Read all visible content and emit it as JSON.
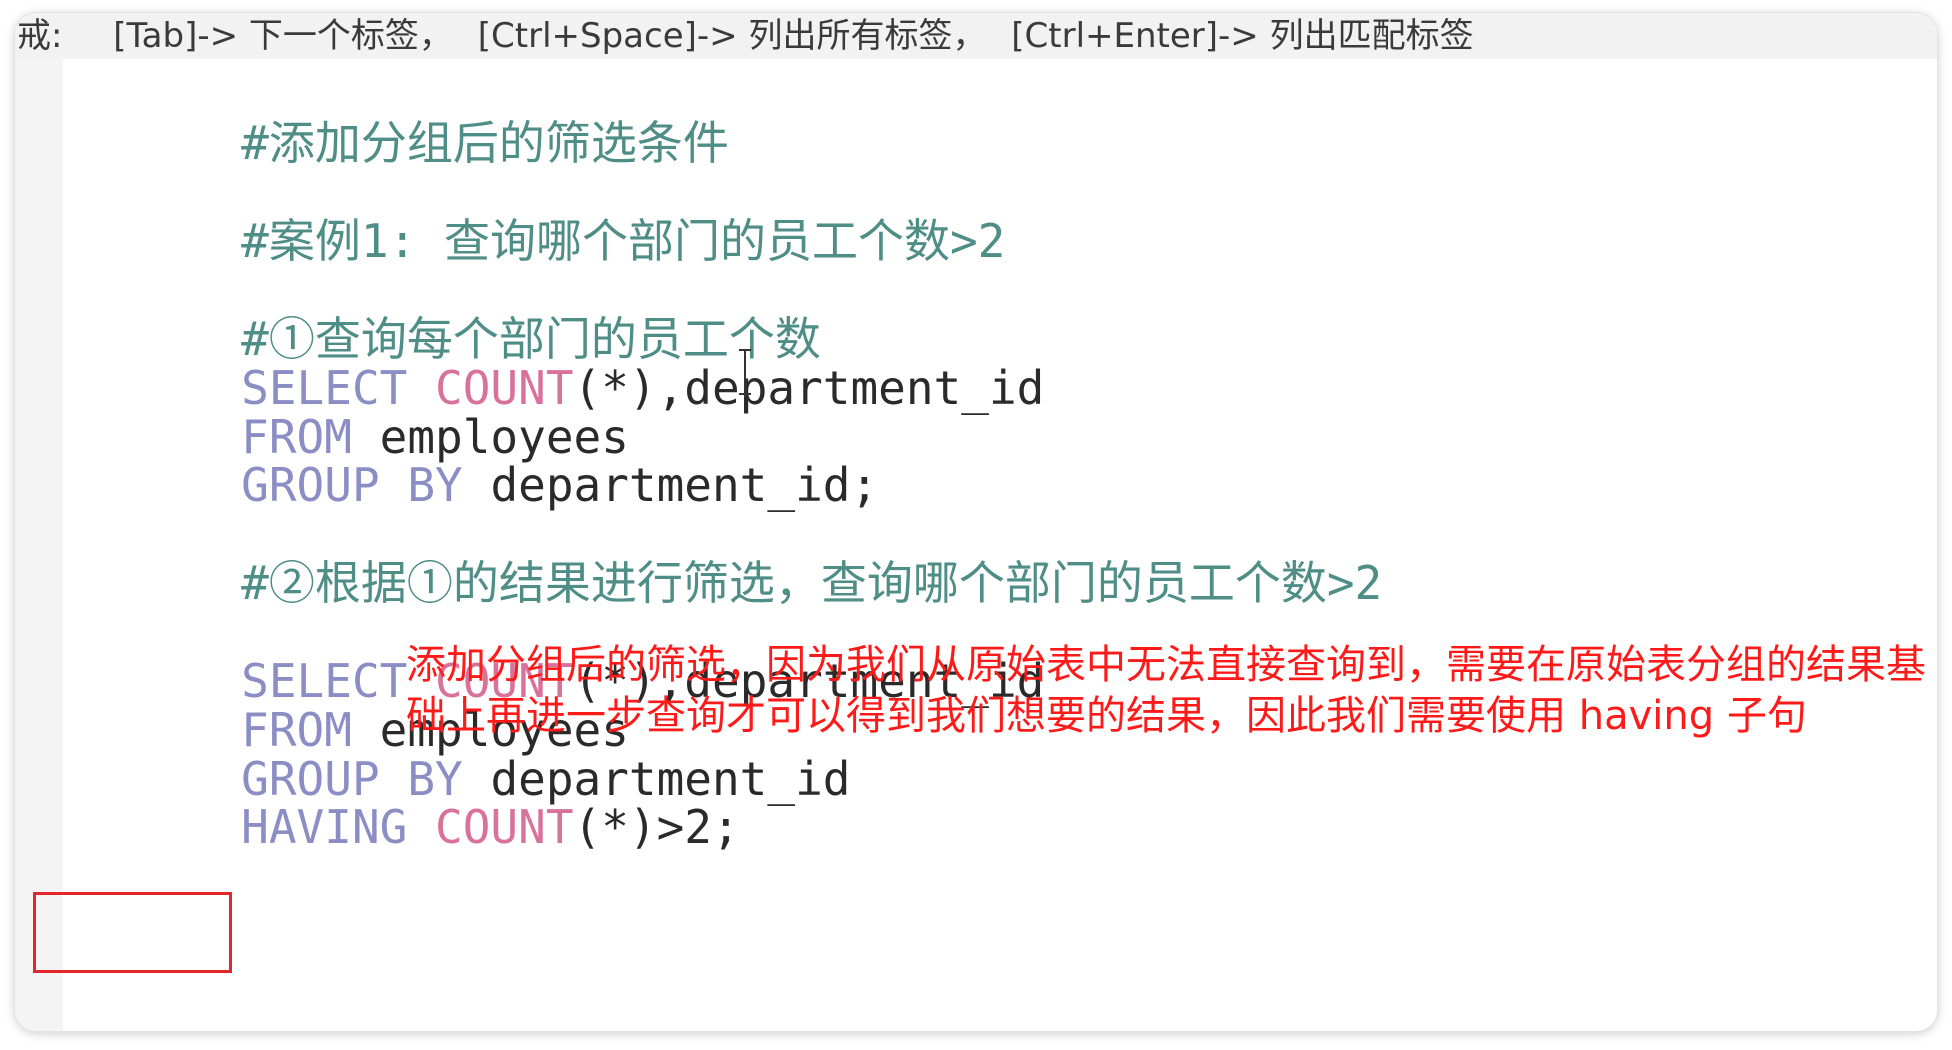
{
  "hint_bar": {
    "prefix": "戒:",
    "items": [
      "[Tab]-> 下一个标签，",
      "[Ctrl+Space]-> 列出所有标签，",
      "[Ctrl+Enter]-> 列出匹配标签"
    ]
  },
  "editor": {
    "lines": [
      {
        "comment": "#添加分组后的筛选条件"
      },
      {
        "comment": "#案例1: 查询哪个部门的员工个数>2"
      },
      {
        "comment": "#①查询每个部门的员工个数"
      },
      {
        "kw": "SELECT",
        "fn": "COUNT",
        "txt": "(*),department_id"
      },
      {
        "kw": "FROM",
        "txt": "employees"
      },
      {
        "kw": "GROUP BY",
        "txt": "department_id;"
      },
      {
        "comment": "#②根据①的结果进行筛选，查询哪个部门的员工个数>2"
      },
      {
        "kw": "SELECT",
        "fn": "COUNT",
        "txt": "(*),department_id"
      },
      {
        "kw": "FROM",
        "txt": "employees"
      },
      {
        "kw": "GROUP BY",
        "txt": "department_id"
      },
      {
        "kw": "HAVING",
        "fn": "COUNT",
        "txt": "(*)>2;"
      }
    ]
  },
  "annotation": {
    "text": "添加分组后的筛选，因为我们从原始表中无法直接查询到，需要在原始表分组的结果基础上再进一步查询才可以得到我们想要的结果，因此我们需要使用 having 子句"
  },
  "colors": {
    "comment": "#4f8d87",
    "keyword": "#8a8ec5",
    "function": "#d8729b",
    "annotation": "#ff1a1a",
    "highlight_box": "#e3262a"
  }
}
